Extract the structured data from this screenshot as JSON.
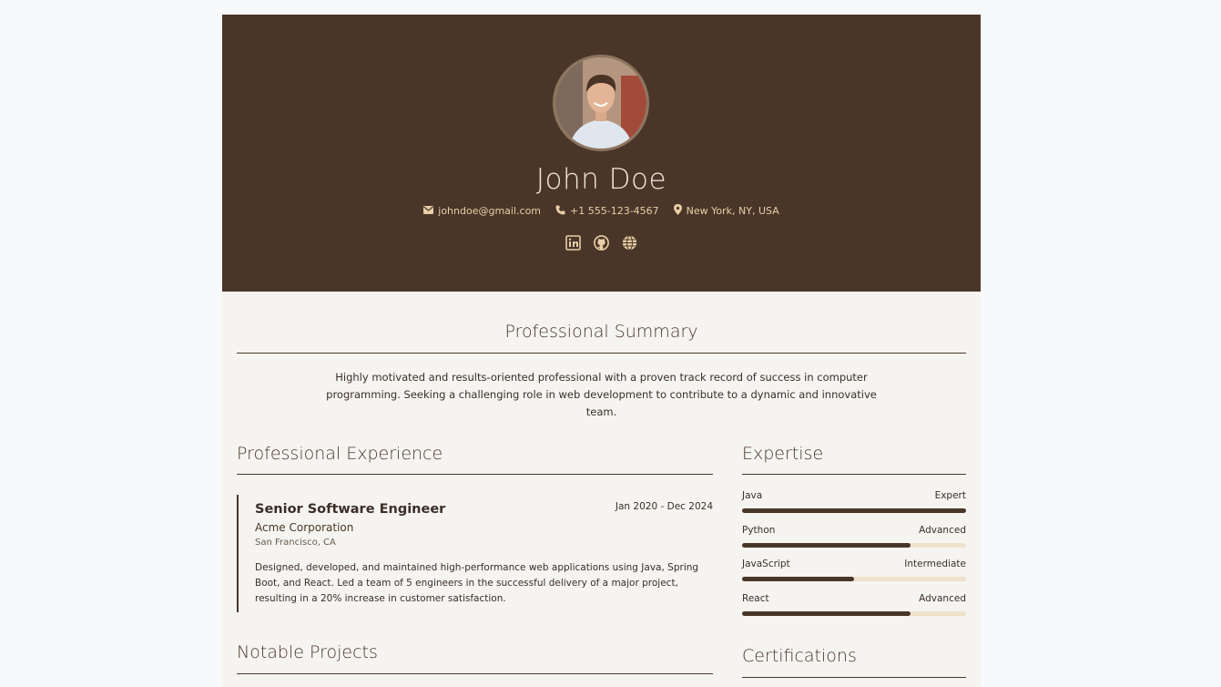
{
  "header": {
    "name": "John Doe",
    "contacts": {
      "email": "johndoe@gmail.com",
      "phone": "+1 555-123-4567",
      "location": "New York, NY, USA"
    },
    "social_icons": [
      "linkedin-icon",
      "github-icon",
      "globe-icon"
    ]
  },
  "summary": {
    "title": "Professional Summary",
    "text": "Highly motivated and results-oriented professional with a proven track record of success in computer programming. Seeking a challenging role in web development to contribute to a dynamic and innovative team."
  },
  "experience": {
    "title": "Professional Experience",
    "jobs": [
      {
        "title": "Senior Software Engineer",
        "dates": "Jan 2020 - Dec 2024",
        "company": "Acme Corporation",
        "location": "San Francisco, CA",
        "description": "Designed, developed, and maintained high-performance web applications using Java, Spring Boot, and React. Led a team of 5 engineers in the successful delivery of a major project, resulting in a 20% increase in customer satisfaction."
      }
    ]
  },
  "projects": {
    "title": "Notable Projects"
  },
  "expertise": {
    "title": "Expertise",
    "skills": [
      {
        "name": "Java",
        "level": "Expert",
        "fraction": 1.0
      },
      {
        "name": "Python",
        "level": "Advanced",
        "fraction": 0.75
      },
      {
        "name": "JavaScript",
        "level": "Intermediate",
        "fraction": 0.5
      },
      {
        "name": "React",
        "level": "Advanced",
        "fraction": 0.75
      }
    ]
  },
  "certifications": {
    "title": "Certifications"
  },
  "colors": {
    "header_bg": "#4a3629",
    "accent": "#e8cda7",
    "page_bg": "#f5f4f1",
    "bar_track": "#efe2cc"
  }
}
